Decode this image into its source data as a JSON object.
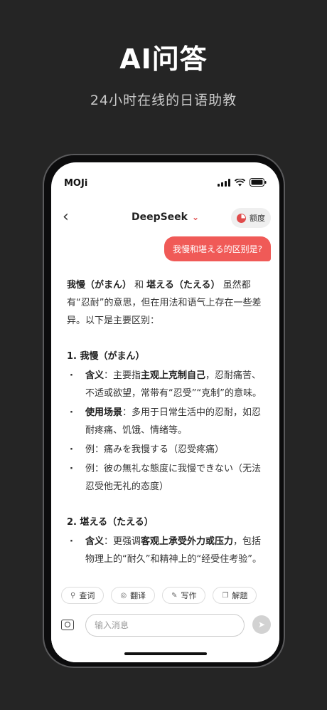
{
  "hero": {
    "title": "AI问答",
    "subtitle": "24小时在线的日语助教"
  },
  "status_bar": {
    "carrier": "MOJi"
  },
  "nav": {
    "title": "DeepSeek",
    "title_chevron": "»",
    "quota_label": "额度"
  },
  "chat": {
    "user_message": "我慢和堪える的区别是?",
    "answer": {
      "intro_a": "我慢（がまん）",
      "intro_and": " 和 ",
      "intro_b": "堪える（たえる）",
      "intro_rest": " 虽然都有“忍耐”的意思，但在用法和语气上存在一些差异。以下是主要区别：",
      "section1": {
        "heading": "1. 我慢（がまん）",
        "points": [
          {
            "label": "含义",
            "sep": "：主要指",
            "em": "主观上克制自己",
            "rest": "，忍耐痛苦、不适或欲望，常带有“忍受”“克制”的意味。"
          },
          {
            "label": "使用场景",
            "sep": "：多用于日常生活中的忍耐，如忍耐疼痛、饥饿、情绪等。",
            "em": "",
            "rest": ""
          },
          {
            "label": "",
            "sep": "例：痛みを我慢する（忍受疼痛）",
            "em": "",
            "rest": ""
          },
          {
            "label": "",
            "sep": "例：彼の無礼な態度に我慢できない（无法忍受他无礼的态度）",
            "em": "",
            "rest": ""
          }
        ]
      },
      "section2": {
        "heading": "2. 堪える（たえる）",
        "points": [
          {
            "label": "含义",
            "sep": "：更强调",
            "em": "客观上承受外力或压力",
            "rest": "，包括物理上的“耐久”和精神上的“经受住考验”。"
          }
        ]
      }
    }
  },
  "quick_actions": [
    {
      "icon": "search-icon",
      "label": "查词"
    },
    {
      "icon": "translate-icon",
      "label": "翻译"
    },
    {
      "icon": "pen-icon",
      "label": "写作"
    },
    {
      "icon": "copy-icon",
      "label": "解题"
    }
  ],
  "composer": {
    "placeholder": "输入消息"
  },
  "colors": {
    "accent": "#f05a57",
    "page_bg": "#252525"
  }
}
